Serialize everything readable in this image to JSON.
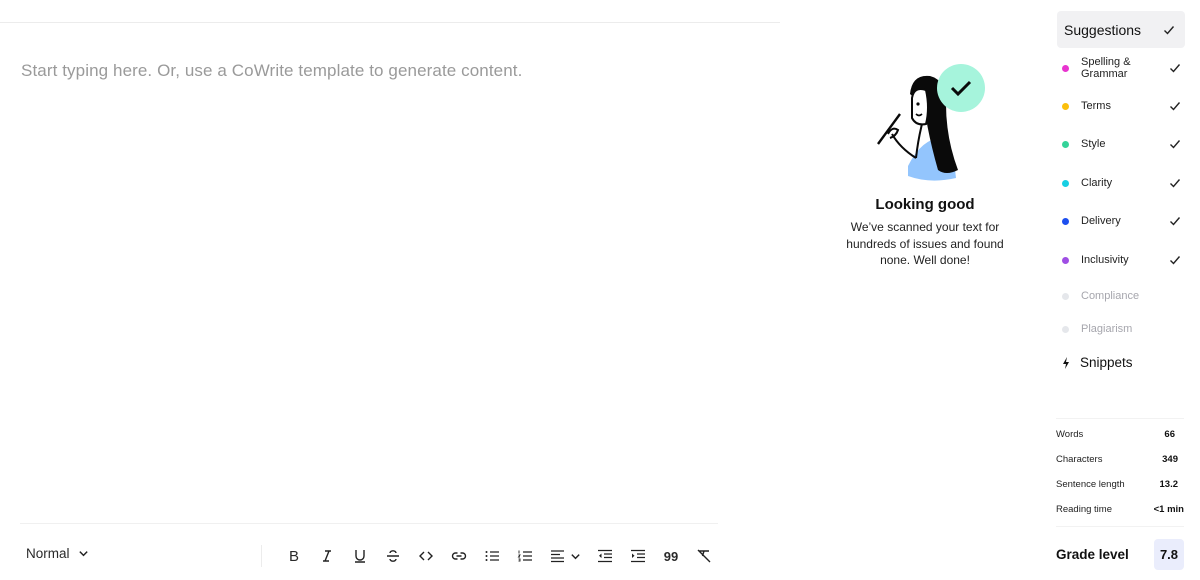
{
  "editor": {
    "placeholder": "Start typing here. Or, use a CoWrite template to generate content."
  },
  "toolbar": {
    "style_select": "Normal",
    "buttons": [
      {
        "name": "bold",
        "icon": "bold-icon"
      },
      {
        "name": "italic",
        "icon": "italic-icon"
      },
      {
        "name": "underline",
        "icon": "underline-icon"
      },
      {
        "name": "strikethrough",
        "icon": "strikethrough-icon"
      },
      {
        "name": "code",
        "icon": "code-icon"
      },
      {
        "name": "link",
        "icon": "link-icon"
      },
      {
        "name": "bullet-list",
        "icon": "bullet-list-icon"
      },
      {
        "name": "numbered-list",
        "icon": "numbered-list-icon"
      },
      {
        "name": "align",
        "icon": "align-left-icon"
      },
      {
        "name": "outdent",
        "icon": "outdent-icon"
      },
      {
        "name": "indent",
        "icon": "indent-icon"
      },
      {
        "name": "quote",
        "icon": "quote-icon"
      },
      {
        "name": "clear-format",
        "icon": "clear-format-icon"
      }
    ],
    "bold_glyph": "B",
    "italic_glyph": "I",
    "underline_glyph": "U",
    "quote_glyph": "99"
  },
  "empty_state": {
    "title": "Looking good",
    "description": "We’ve scanned your text for hundreds of issues and found none. Well done!",
    "badge_color": "#a6f4dc",
    "shirt_color": "#93c5fd"
  },
  "suggestions": {
    "header": "Suggestions",
    "items": [
      {
        "label": "Spelling & Grammar",
        "color": "#e834cf",
        "checked": true,
        "enabled": true
      },
      {
        "label": "Terms",
        "color": "#fbbf0c",
        "checked": true,
        "enabled": true
      },
      {
        "label": "Style",
        "color": "#34d399",
        "checked": true,
        "enabled": true
      },
      {
        "label": "Clarity",
        "color": "#17cfe3",
        "checked": true,
        "enabled": true
      },
      {
        "label": "Delivery",
        "color": "#1d4fef",
        "checked": true,
        "enabled": true
      },
      {
        "label": "Inclusivity",
        "color": "#9f4ee4",
        "checked": true,
        "enabled": true
      },
      {
        "label": "Compliance",
        "color": "#e5e7eb",
        "checked": false,
        "enabled": false
      },
      {
        "label": "Plagiarism",
        "color": "#e5e7eb",
        "checked": false,
        "enabled": false
      }
    ],
    "snippets": "Snippets"
  },
  "stats": [
    {
      "label": "Words",
      "value": "66"
    },
    {
      "label": "Characters",
      "value": "349"
    },
    {
      "label": "Sentence length",
      "value": "13.2"
    },
    {
      "label": "Reading time",
      "value": "<1 min"
    }
  ],
  "grade": {
    "label": "Grade level",
    "value": "7.8"
  }
}
